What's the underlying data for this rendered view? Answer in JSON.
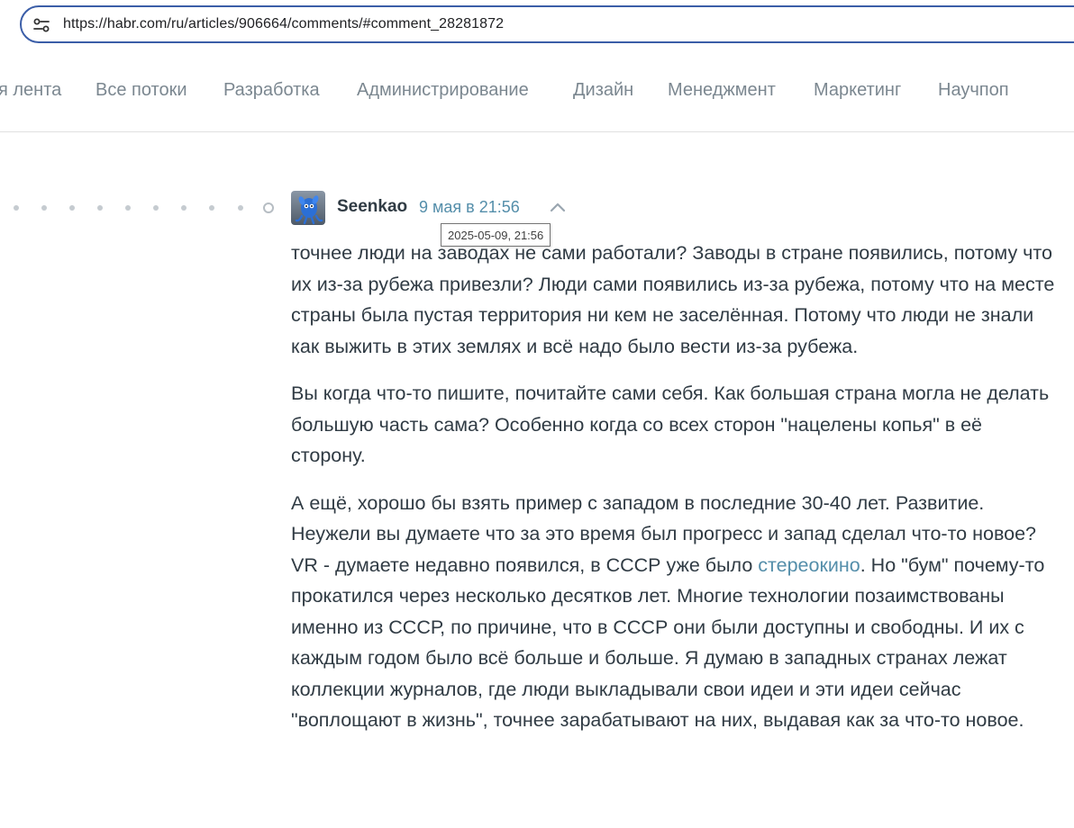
{
  "browser": {
    "url": "https://habr.com/ru/articles/906664/comments/#comment_28281872",
    "site_info_icon": "tune-icon"
  },
  "nav": {
    "items": [
      {
        "label": "я лента"
      },
      {
        "label": "Все потоки"
      },
      {
        "label": "Разработка"
      },
      {
        "label": "Администрирование"
      },
      {
        "label": "Дизайн"
      },
      {
        "label": "Менеджмент"
      },
      {
        "label": "Маркетинг"
      },
      {
        "label": "Научпоп"
      }
    ]
  },
  "comment": {
    "author": "Seenkao",
    "date": "9 мая в 21:56",
    "tooltip": "2025-05-09, 21:56",
    "collapse_icon": "chevron-up-icon",
    "paragraphs": [
      {
        "text": "точнее люди на заводах не сами работали? Заводы в стране появились, потому что их из-за рубежа привезли? Люди сами появились из-за рубежа, потому что на месте страны была пустая территория ни кем не заселённая. Потому что люди не знали как выжить в этих землях и всё надо было вести из-за рубежа."
      },
      {
        "text": "Вы когда что-то пишите, почитайте сами себя. Как большая страна могла не делать большую часть сама? Особенно когда со всех сторон \"нацелены копья\" в её сторону."
      },
      {
        "before": "А ещё, хорошо бы взять пример с западом в последние 30-40 лет. Развитие. Неужели вы думаете что за это время был прогресс и запад сделал что-то новое? VR - думаете недавно появился, в СССР уже было ",
        "link": "стереокино",
        "after": ". Но \"бум\" почему-то прокатился через несколько десятков лет. Многие технологии позаимствованы именно из СССР, по причине, что в СССР они были доступны и свободны. И их с каждым годом было всё больше и больше. Я думаю в западных странах лежат коллекции журналов, где люди выкладывали свои идеи и эти идеи сейчас \"воплощают в жизнь\", точнее зарабатывают на них, выдавая как за что-то новое."
      }
    ]
  },
  "colors": {
    "accent_link": "#548eaa",
    "nav_text": "#7b8790",
    "body_text": "#303b44",
    "url_border": "#3b5ea8"
  }
}
